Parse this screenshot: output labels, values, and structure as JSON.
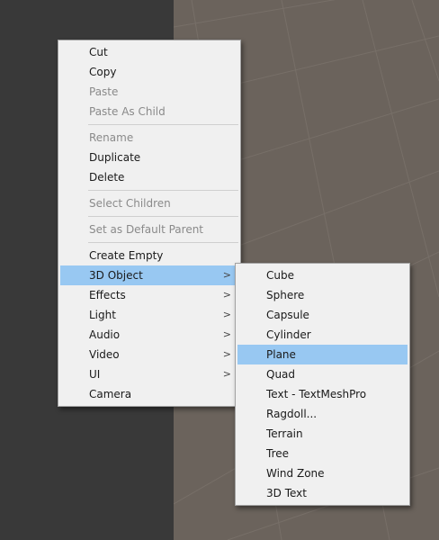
{
  "context_menu": {
    "items": [
      {
        "label": "Cut",
        "enabled": true
      },
      {
        "label": "Copy",
        "enabled": true
      },
      {
        "label": "Paste",
        "enabled": false
      },
      {
        "label": "Paste As Child",
        "enabled": false
      },
      {
        "label": "Rename",
        "enabled": false
      },
      {
        "label": "Duplicate",
        "enabled": true
      },
      {
        "label": "Delete",
        "enabled": true
      },
      {
        "label": "Select Children",
        "enabled": false
      },
      {
        "label": "Set as Default Parent",
        "enabled": false
      },
      {
        "label": "Create Empty",
        "enabled": true
      },
      {
        "label": "3D Object",
        "enabled": true,
        "submenu": true,
        "highlighted": true
      },
      {
        "label": "Effects",
        "enabled": true,
        "submenu": true
      },
      {
        "label": "Light",
        "enabled": true,
        "submenu": true
      },
      {
        "label": "Audio",
        "enabled": true,
        "submenu": true
      },
      {
        "label": "Video",
        "enabled": true,
        "submenu": true
      },
      {
        "label": "UI",
        "enabled": true,
        "submenu": true
      },
      {
        "label": "Camera",
        "enabled": true
      }
    ],
    "submenu_arrow": ">"
  },
  "submenu_3d_object": {
    "items": [
      {
        "label": "Cube"
      },
      {
        "label": "Sphere"
      },
      {
        "label": "Capsule"
      },
      {
        "label": "Cylinder"
      },
      {
        "label": "Plane",
        "highlighted": true
      },
      {
        "label": "Quad"
      },
      {
        "label": "Text - TextMeshPro"
      },
      {
        "label": "Ragdoll..."
      },
      {
        "label": "Terrain"
      },
      {
        "label": "Tree"
      },
      {
        "label": "Wind Zone"
      },
      {
        "label": "3D Text"
      }
    ]
  },
  "colors": {
    "hierarchy_bg": "#393939",
    "scene_bg": "#6b635c",
    "menu_bg": "#f0f0f0",
    "highlight": "#98c8f2",
    "disabled_text": "#8a8a8a"
  }
}
